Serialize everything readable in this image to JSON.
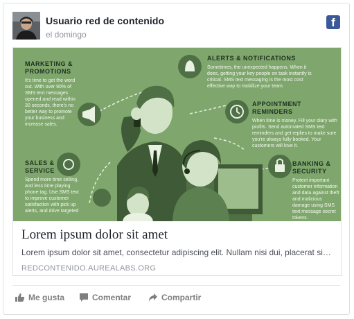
{
  "post": {
    "author": "Usuario red de contenido",
    "time": "el domingo",
    "platform_icon": "facebook-icon"
  },
  "infographic": {
    "sections": [
      {
        "title": "MARKETING &\nPROMOTIONS",
        "body": "It's time to get the word out. With over 90% of SMS text messages opened and read within 30 seconds, there's no better way to promote your business and increase sales."
      },
      {
        "title": "ALERTS & NOTIFICATIONS",
        "body": "Sometimes, the unexpected happens. When it does, getting your key people on task instantly is critical. SMS text messaging is the most cost effective way to mobilize your team."
      },
      {
        "title": "APPOINTMENT REMINDERS",
        "body": "When time is money. Fill your diary with profits. Send automated SMS text reminders and get replies to make sure you're always fully booked. Your customers will love it."
      },
      {
        "title": "SALES &\nSERVICE",
        "body": "Spend more time selling, and less time playing phone tag. Use SMS text to improve customer satisfaction with pick up alerts, and drive targeted"
      },
      {
        "title": "BANKING &\nSECURITY",
        "body": "Protect important customer information and data against theft and malicious damage using SMS text message secret tokens."
      }
    ]
  },
  "link": {
    "title": "Lorem ipsum dolor sit amet",
    "description": "Lorem ipsum dolor sit amet, consectetur adipiscing elit. Nullam nisi dui, placerat sit amet",
    "domain": "REDCONTENIDO.AUREALABS.ORG"
  },
  "actions": {
    "like": "Me gusta",
    "comment": "Comentar",
    "share": "Compartir"
  },
  "colors": {
    "infographic_green": "#7fa76d",
    "facebook_blue": "#3b5998",
    "muted_text": "#90949c"
  }
}
